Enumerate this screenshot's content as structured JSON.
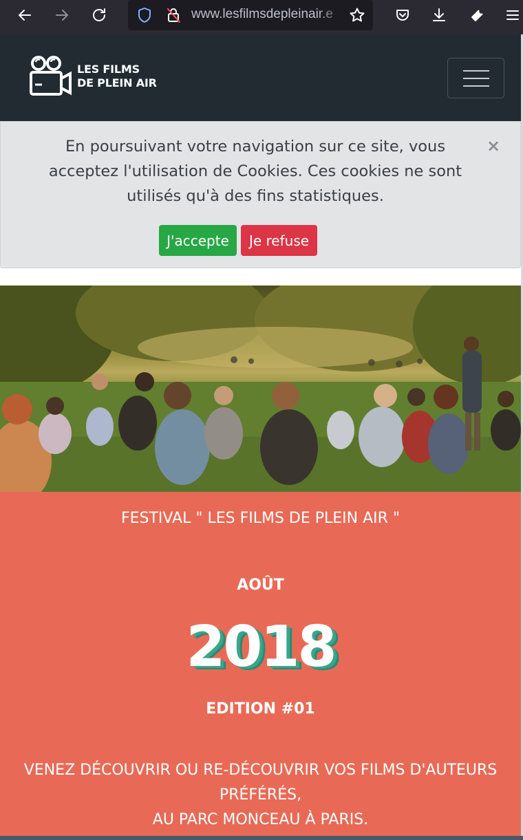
{
  "browser": {
    "url": "www.lesfilmsdepleinair.e",
    "icons": [
      "back-icon",
      "forward-icon",
      "reload-icon",
      "shield-icon",
      "lock-off-icon",
      "star-icon",
      "pocket-icon",
      "download-icon",
      "wrench-icon",
      "menu-icon"
    ]
  },
  "site": {
    "logo_line1": "LES FILMS",
    "logo_line2": "DE PLEIN AIR"
  },
  "cookie": {
    "message": "En poursuivant votre navigation sur ce site, vous acceptez l'utilisation de Cookies. Ces cookies ne sont utilisés qu'à des fins statistiques.",
    "close_label": "×",
    "accept_label": "J'accepte",
    "refuse_label": "Je refuse"
  },
  "festival": {
    "title": "FESTIVAL \" LES FILMS DE PLEIN AIR \"",
    "month": "AOÛT",
    "year": "2018",
    "edition": "EDITION #01",
    "desc_line1": "VENEZ DÉCOUVRIR OU RE-DÉCOUVRIR VOS FILMS D'AUTEURS PRÉFÉRÉS,",
    "desc_line2": "AU PARC MONCEAU À PARIS."
  },
  "colors": {
    "navbar": "#212b31",
    "festival": "#e86a56",
    "accept": "#28a745",
    "refuse": "#dc3545",
    "year_shadow": "#3aa58a"
  }
}
